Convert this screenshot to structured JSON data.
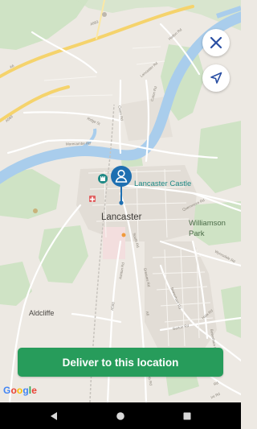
{
  "map": {
    "city_label": "Lancaster",
    "landmark_label": "Lancaster Castle",
    "park_label_line1": "Williamson",
    "park_label_line2": "Park",
    "village_label": "Aldcliffe",
    "roads": {
      "a6": "A6",
      "a589": "A589",
      "a683": "A683",
      "halton": "Halton Rd",
      "lancaster_rd": "Lancaster Rd",
      "morecambe": "Morecambe Rd",
      "owen": "Owen Rd",
      "caton": "Caton Rd",
      "ridge": "Ridge St",
      "quernmore": "Quernmore Rd",
      "wyresdale": "Wyresdale Rd",
      "south": "South Rd",
      "greaves": "Greaves Rd",
      "ashton": "Ashton Rd",
      "bowerham": "Bowerham Rd",
      "hala": "Hala Rd",
      "barton": "Barton Rd",
      "a588": "A588",
      "a6s": "A6",
      "bowerham2": "Bowerham Ln",
      "scotforth": "Scotforth Rd",
      "irl": "Ire Rd",
      "rt": "Rd"
    },
    "attribution": [
      "G",
      "o",
      "o",
      "g",
      "l",
      "e"
    ]
  },
  "controls": {
    "close_icon": "close-icon",
    "locate_icon": "navigation-arrow-icon"
  },
  "marker": {
    "icon": "person-pin-icon",
    "color": "#1e6fb1"
  },
  "action": {
    "deliver_label": "Deliver to this location",
    "color": "#279c5b"
  },
  "system_nav": {
    "back_icon": "back-triangle-icon",
    "home_icon": "home-circle-icon",
    "recents_icon": "recents-square-icon"
  }
}
